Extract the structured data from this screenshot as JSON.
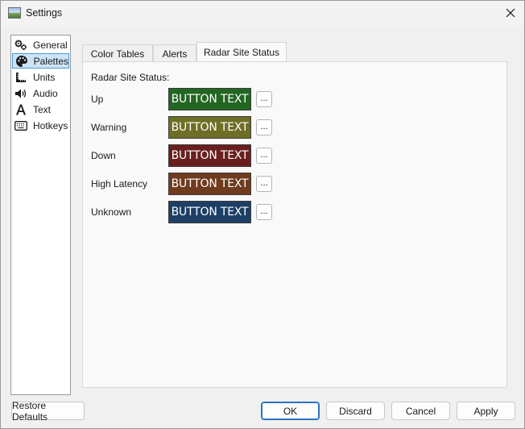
{
  "window": {
    "title": "Settings"
  },
  "sidebar": {
    "items": [
      {
        "label": "General",
        "icon": "gears-icon"
      },
      {
        "label": "Palettes",
        "icon": "palette-icon",
        "selected": true
      },
      {
        "label": "Units",
        "icon": "ruler-icon"
      },
      {
        "label": "Audio",
        "icon": "speaker-icon"
      },
      {
        "label": "Text",
        "icon": "font-icon"
      },
      {
        "label": "Hotkeys",
        "icon": "keyboard-icon"
      }
    ]
  },
  "tabs": [
    {
      "label": "Color Tables"
    },
    {
      "label": "Alerts"
    },
    {
      "label": "Radar Site Status",
      "active": true
    }
  ],
  "panel": {
    "section_label": "Radar Site Status:",
    "rows": [
      {
        "label": "Up",
        "button_text": "BUTTON TEXT",
        "color": "#226622",
        "dots": "..."
      },
      {
        "label": "Warning",
        "button_text": "BUTTON TEXT",
        "color": "#6e6e26",
        "dots": "..."
      },
      {
        "label": "Down",
        "button_text": "BUTTON TEXT",
        "color": "#6a1f1f",
        "dots": "..."
      },
      {
        "label": "High Latency",
        "button_text": "BUTTON TEXT",
        "color": "#6e3b1e",
        "dots": "..."
      },
      {
        "label": "Unknown",
        "button_text": "BUTTON TEXT",
        "color": "#1d3f66",
        "dots": "..."
      }
    ]
  },
  "footer": {
    "restore_defaults": "Restore Defaults",
    "ok": "OK",
    "discard": "Discard",
    "cancel": "Cancel",
    "apply": "Apply"
  },
  "colors": {
    "selection_bg": "#cce4f7",
    "selection_border": "#4e9bd6",
    "default_button_border": "#2b72c2"
  }
}
